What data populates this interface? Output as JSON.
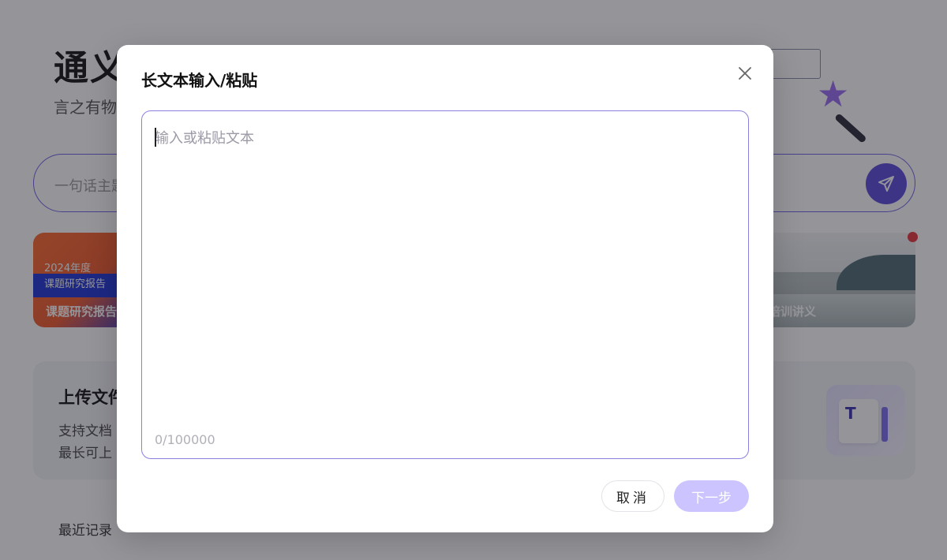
{
  "background": {
    "brand_title": "通义",
    "brand_subtitle": "言之有物",
    "search_placeholder": "一句话主题",
    "template_cards": [
      {
        "year": "2024年度",
        "topic": "课题研究报告",
        "caption": "课题研究报告"
      },
      {
        "caption": "培训讲义"
      }
    ],
    "upload": {
      "title": "上传文件",
      "desc_line1": "支持文档",
      "desc_line2": "最长可上"
    },
    "recent_label": "最近记录"
  },
  "modal": {
    "title": "长文本输入/粘贴",
    "textarea_placeholder": "输入或粘贴文本",
    "char_count": "0/100000",
    "cancel_label": "取消",
    "next_label": "下一步"
  },
  "colors": {
    "accent": "#5b4bdb",
    "next_disabled": "#cbc4ff",
    "overlay": "#1c1c26"
  },
  "icons": {
    "close": "close-icon",
    "send": "send-icon",
    "document": "document-icon"
  }
}
